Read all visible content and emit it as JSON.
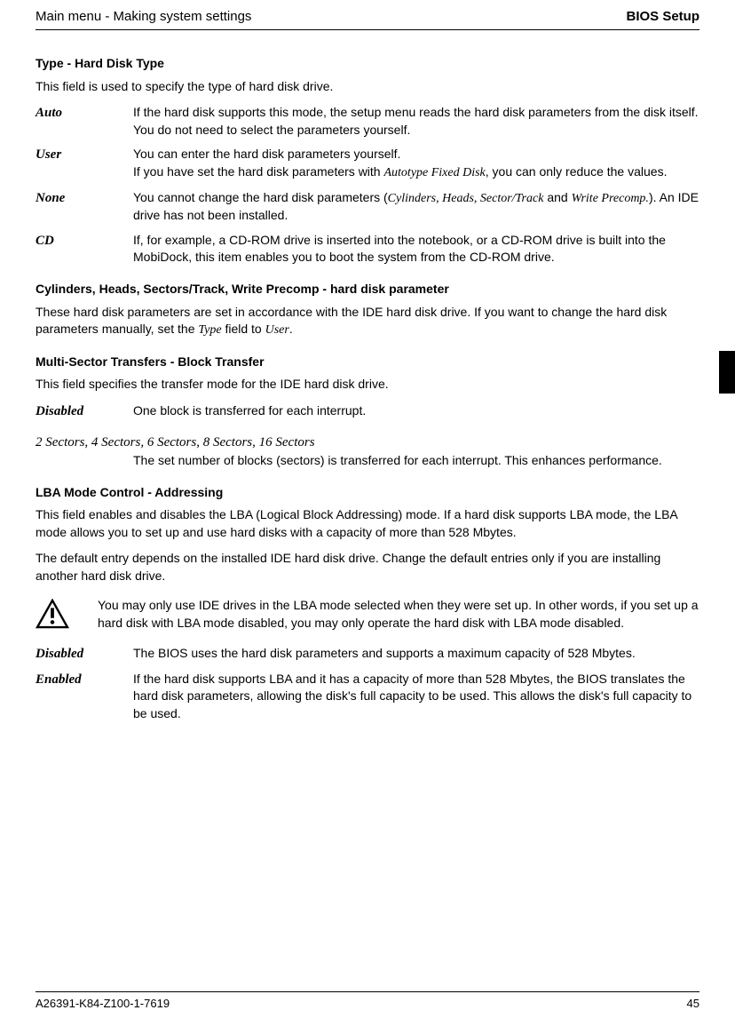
{
  "header": {
    "left": "Main menu - Making system settings",
    "right": "BIOS Setup"
  },
  "s1": {
    "title": "Type - Hard Disk Type",
    "intro": "This field is used to specify the type of hard disk drive.",
    "auto_term": "Auto",
    "auto_desc": "If the hard disk supports this mode, the setup menu reads the hard disk parameters from the disk itself. You do not need to select the parameters yourself.",
    "user_term": "User",
    "user_line1": "You can enter the hard disk parameters yourself.",
    "user_line2a": "If you have set the hard disk parameters with ",
    "user_line2b": "Autotype Fixed Disk",
    "user_line2c": ", you can only reduce the values.",
    "none_term": "None",
    "none_a": "You cannot change the hard disk parameters (",
    "none_b": "Cylinders, Heads, Sector/Track",
    "none_c": " and ",
    "none_d": "Write Precomp.",
    "none_e": "). An IDE drive has not been installed.",
    "cd_term": "CD",
    "cd_desc": "If, for example, a CD-ROM drive is inserted into the notebook, or a CD-ROM drive is built into the MobiDock, this item enables you to boot the system from the CD-ROM drive."
  },
  "s2": {
    "title": "Cylinders, Heads, Sectors/Track, Write Precomp - hard disk parameter",
    "p_a": "These hard disk parameters are set in accordance with the IDE hard disk drive. If you want to change the hard disk parameters manually, set the ",
    "p_b": "Type",
    "p_c": " field to ",
    "p_d": "User",
    "p_e": "."
  },
  "s3": {
    "title": "Multi-Sector Transfers - Block Transfer",
    "intro": "This field specifies the transfer mode for the IDE hard disk drive.",
    "disabled_term": "Disabled",
    "disabled_desc": "One block is transferred for each interrupt.",
    "sectors_line": "2 Sectors, 4 Sectors, 6 Sectors, 8 Sectors, 16 Sectors",
    "sectors_desc": "The set number of blocks (sectors) is transferred for each interrupt. This enhances performance."
  },
  "s4": {
    "title": "LBA Mode Control - Addressing",
    "p1": "This field enables and disables the LBA (Logical Block Addressing) mode. If a hard disk supports LBA mode, the LBA mode allows you to set up and use hard disks with a capacity of more than 528 Mbytes.",
    "p2": "The default entry depends on the installed IDE hard disk drive. Change the default entries only if you are installing another hard disk drive.",
    "warning": "You may only use IDE drives in the LBA mode selected when they were set up. In other words, if you set up a hard disk with LBA mode disabled, you may only operate the hard disk with LBA mode disabled.",
    "disabled_term": "Disabled",
    "disabled_desc": "The BIOS uses the hard disk parameters and supports a maximum capacity of 528 Mbytes.",
    "enabled_term": "Enabled",
    "enabled_desc": "If the hard disk supports LBA and it has a capacity of more than 528 Mbytes, the BIOS translates the hard disk parameters, allowing the disk's full capacity to be used. This allows the disk's full capacity to be used."
  },
  "footer": {
    "left": "A26391-K84-Z100-1-7619",
    "right": "45"
  }
}
